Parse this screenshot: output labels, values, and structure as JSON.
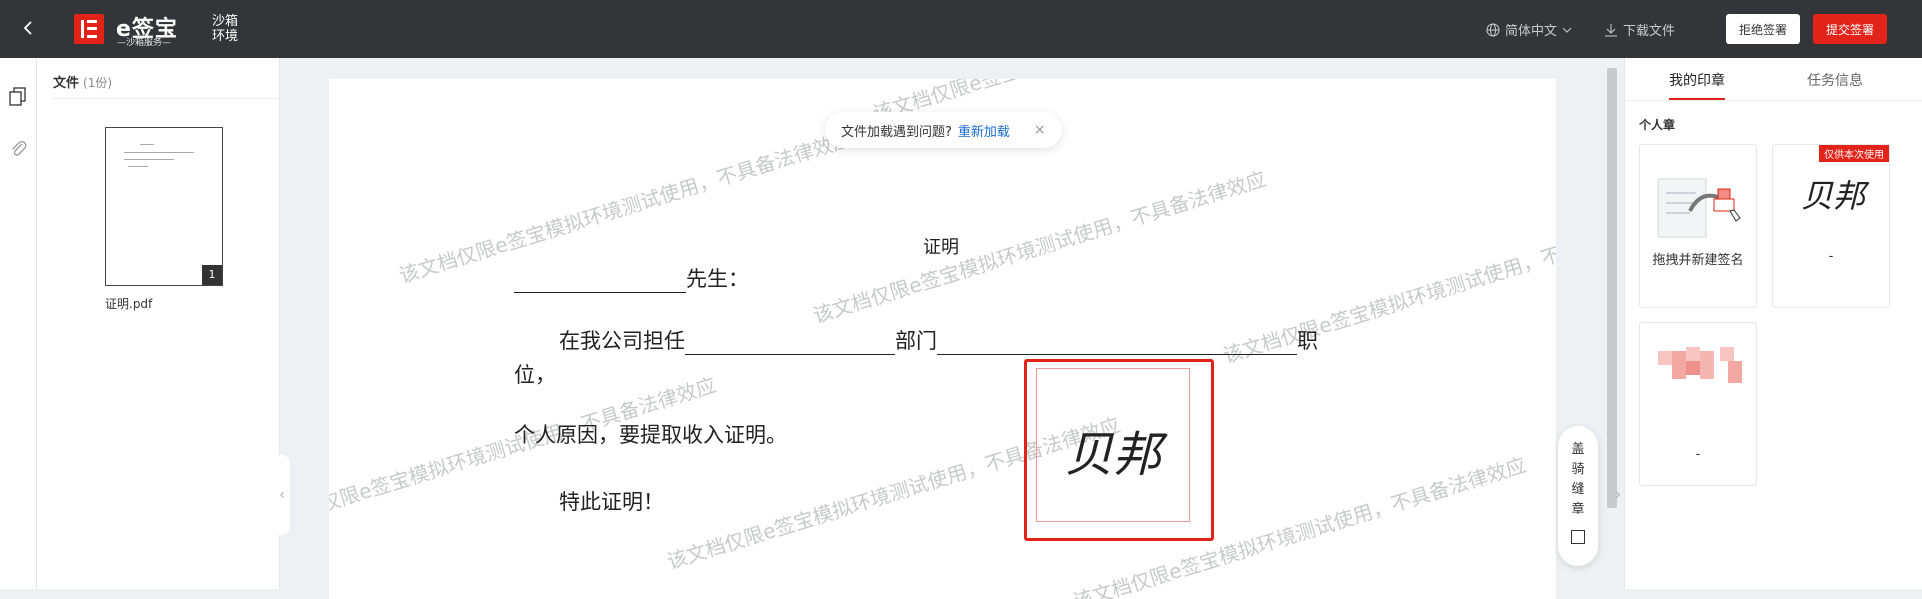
{
  "topbar": {
    "back_icon": "chevron-left-icon",
    "logo_text": "e签宝",
    "logo_sub": "—沙箱服务—",
    "env_label": "沙箱环境",
    "language": "简体中文",
    "download": "下载文件",
    "reject_label": "拒绝签署",
    "submit_label": "提交签署"
  },
  "filepanel": {
    "title": "文件",
    "count": "(1份)",
    "page_number": "1",
    "file_name": "证明.pdf"
  },
  "notice": {
    "text": "文件加载遇到问题?",
    "link": "重新加载",
    "close": "×"
  },
  "document": {
    "title": "证明",
    "line1": "先生：",
    "line2_a": "在我公司担任",
    "line2_b": "部门",
    "line2_c": "职",
    "line3": "位，",
    "line4": "个人原因，要提取收入证明。",
    "line5": "特此证明！",
    "signature": "贝邦",
    "watermark": "该文档仅限e签宝模拟环境测试使用，不具备法律效应"
  },
  "ride_seal": {
    "label": "盖骑缝章"
  },
  "rightpanel": {
    "tabs": [
      "我的印章",
      "任务信息"
    ],
    "section": "个人章",
    "card1_label": "拖拽并新建签名",
    "card2_badge": "仅供本次使用",
    "card2_signature": "贝邦",
    "card2_label": "-",
    "card3_label": "-"
  },
  "colors": {
    "accent": "#e2231a",
    "topbar": "#333538",
    "link": "#1a6cd6"
  }
}
